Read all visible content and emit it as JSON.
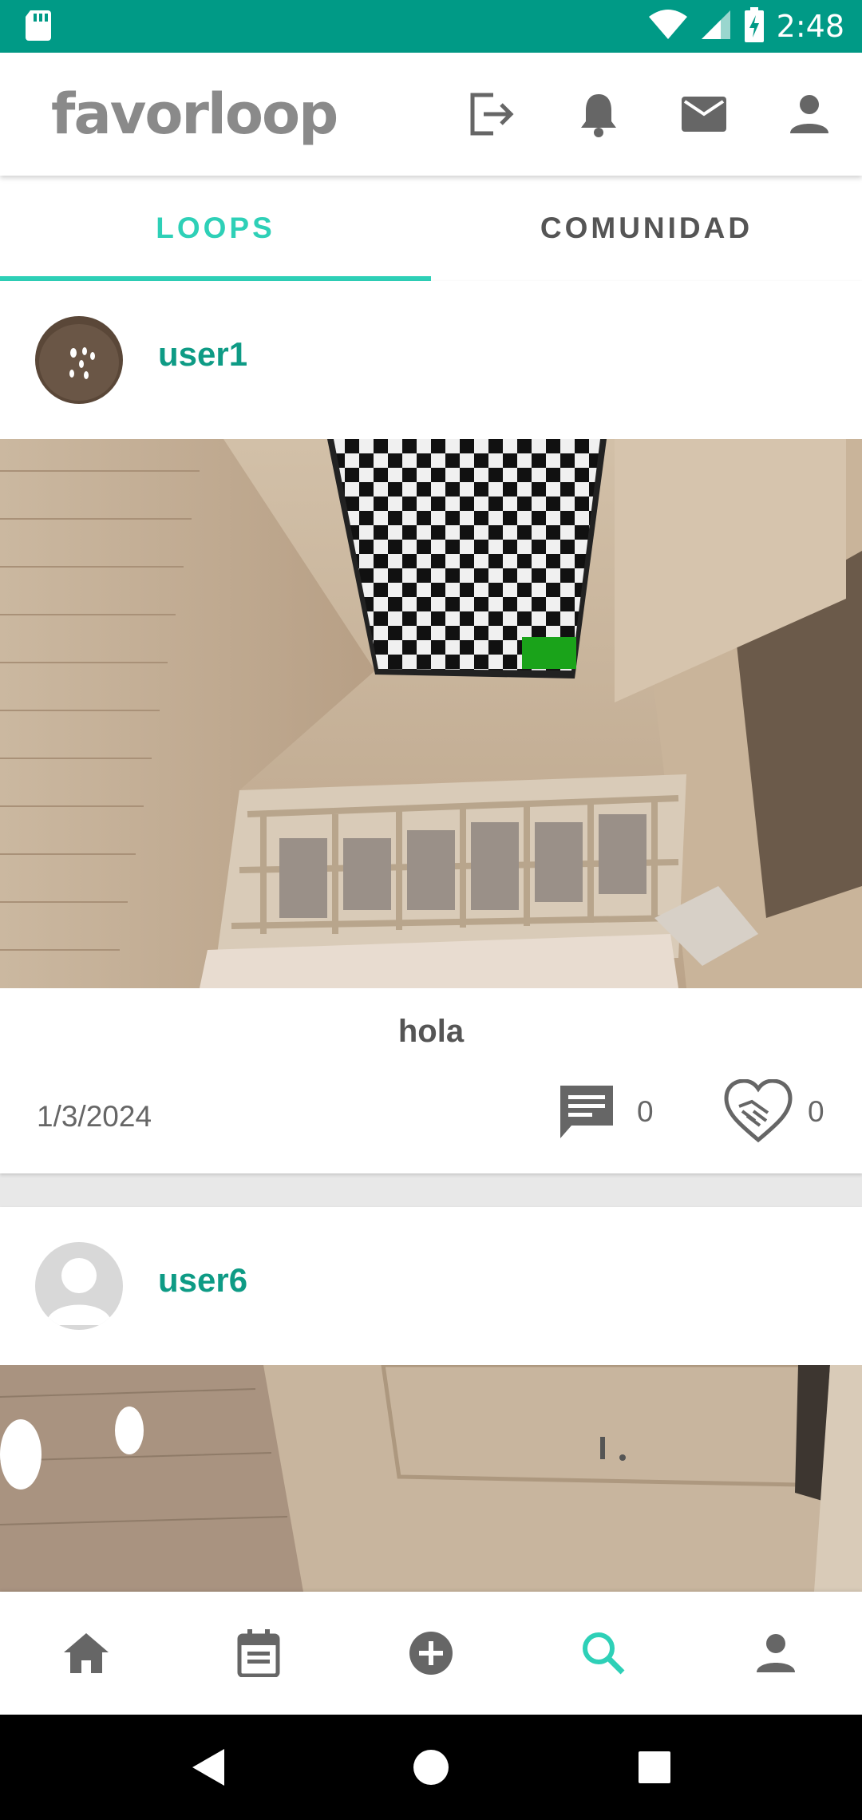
{
  "status_bar": {
    "time": "2:48",
    "icons": [
      "sd-card-icon",
      "wifi-icon",
      "signal-icon",
      "battery-charging-icon"
    ]
  },
  "app_bar": {
    "logo_text": "favorloop",
    "icons": [
      "logout-icon",
      "bell-icon",
      "mail-icon",
      "account-icon"
    ]
  },
  "tabs": [
    {
      "label": "LOOPS",
      "active": true
    },
    {
      "label": "COMUNIDAD",
      "active": false
    }
  ],
  "posts": [
    {
      "username": "user1",
      "caption": "hola",
      "date": "1/3/2024",
      "comments": "0",
      "favors": "0"
    },
    {
      "username": "user6"
    }
  ],
  "bottom_nav": {
    "items": [
      "home-icon",
      "calendar-icon",
      "add-circle-icon",
      "search-icon",
      "person-icon"
    ],
    "active": "search-icon"
  },
  "colors": {
    "status_bar": "#009a86",
    "accent": "#2ed0b7",
    "username": "#0e9b85"
  }
}
